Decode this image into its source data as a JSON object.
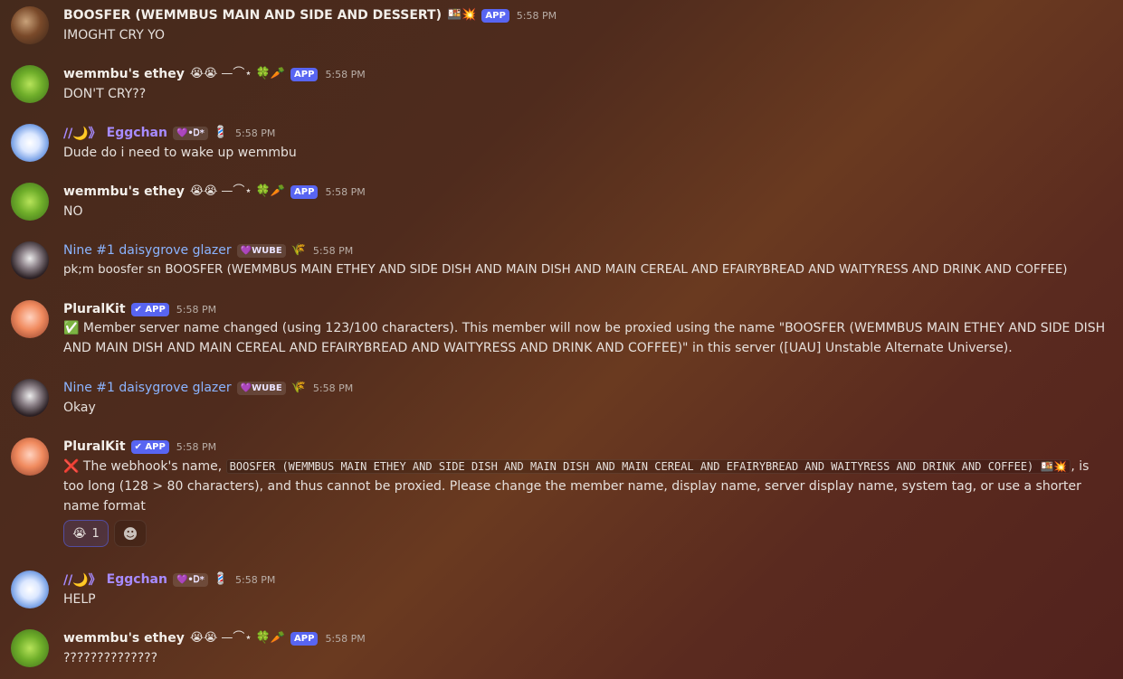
{
  "messages": [
    {
      "author": "BOOSFER (WEMMBUS MAIN AND SIDE AND DESSERT)",
      "author_emojis": "🍱💥",
      "badge": "APP",
      "time": "5:58 PM",
      "text": "IMOGHT CRY YO"
    },
    {
      "author": "wemmbu's ethey",
      "author_emojis": "😭😭 —⌒⋆ 🍀🥕",
      "badge": "APP",
      "time": "5:58 PM",
      "text": "DON'T CRY??"
    },
    {
      "author_prefix": "//🌙》",
      "author": "Eggchan",
      "tag": "💜•Ꭰ*",
      "author_suffix_emoji": "💈",
      "time": "5:58 PM",
      "text": "Dude do i need to wake up wemmbu"
    },
    {
      "author": "wemmbu's ethey",
      "author_emojis": "😭😭 —⌒⋆ 🍀🥕",
      "badge": "APP",
      "time": "5:58 PM",
      "text": "NO"
    },
    {
      "author": "Nine #1 daisygrove glazer",
      "tag": "💜WUBE",
      "author_suffix_emoji": "🌾",
      "time": "5:58 PM",
      "text": "pk;m boosfer sn BOOSFER (WEMMBUS MAIN ETHEY AND SIDE DISH AND MAIN DISH AND MAIN CEREAL AND EFAIRYBREAD AND WAITYRESS AND DRINK AND COFFEE)"
    },
    {
      "author": "PluralKit",
      "badge": "✔ APP",
      "time": "5:58 PM",
      "text_icon": "✅",
      "text": "Member server name changed (using 123/100 characters). This member will now be proxied using the name \"BOOSFER (WEMMBUS MAIN ETHEY AND SIDE DISH AND MAIN DISH AND MAIN CEREAL AND EFAIRYBREAD AND WAITYRESS AND DRINK AND COFFEE)\" in this server ([UAU] Unstable Alternate Universe)."
    },
    {
      "author": "Nine #1 daisygrove glazer",
      "tag": "💜WUBE",
      "author_suffix_emoji": "🌾",
      "time": "5:58 PM",
      "text": "Okay"
    },
    {
      "author": "PluralKit",
      "badge": "✔ APP",
      "time": "5:58 PM",
      "text_icon": "❌",
      "text_before": "The webhook's name,",
      "code": "BOOSFER (WEMMBUS MAIN ETHEY AND SIDE DISH AND MAIN DISH AND MAIN CEREAL AND EFAIRYBREAD AND WAITYRESS AND DRINK AND COFFEE) 🍱💥",
      "text_after": ", is too long (128 > 80 characters), and thus cannot be proxied. Please change the member name, display name, server display name, system tag, or use a shorter name format",
      "reaction": {
        "emoji": "😭",
        "count": "1"
      },
      "add_reaction_icon": "☻"
    },
    {
      "author_prefix": "//🌙》",
      "author": "Eggchan",
      "tag": "💜•Ꭰ*",
      "author_suffix_emoji": "💈",
      "time": "5:58 PM",
      "text": "HELP"
    },
    {
      "author": "wemmbu's ethey",
      "author_emojis": "😭😭 —⌒⋆ 🍀🥕",
      "badge": "APP",
      "time": "5:58 PM",
      "text": "??????????????"
    }
  ]
}
